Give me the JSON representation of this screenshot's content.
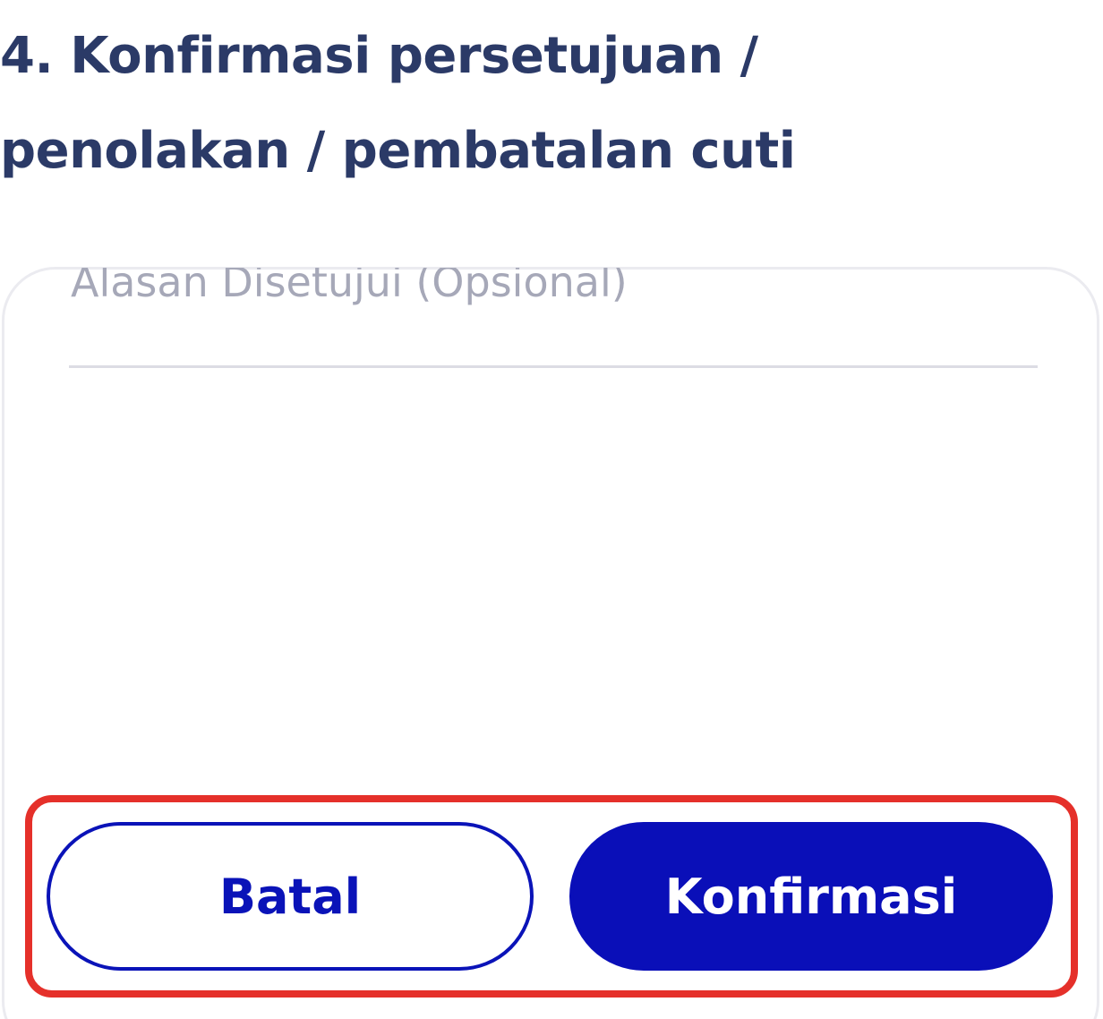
{
  "page": {
    "heading": "4. Konfirmasi persetujuan / penolakan / pembatalan cuti"
  },
  "form": {
    "reason_placeholder": "Alasan Disetujui (Opsional)",
    "reason_value": ""
  },
  "actions": {
    "cancel_label": "Batal",
    "confirm_label": "Konfirmasi"
  },
  "colors": {
    "heading": "#2b3a67",
    "primary": "#0a0fb8",
    "highlight": "#e5302a",
    "placeholder": "#a6a8b8"
  }
}
